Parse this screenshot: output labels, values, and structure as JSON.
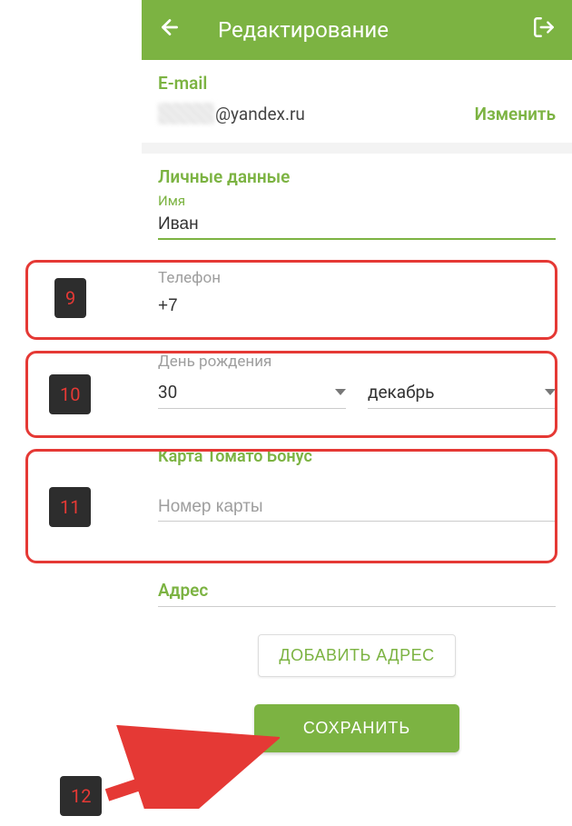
{
  "header": {
    "title": "Редактирование"
  },
  "email": {
    "label": "E-mail",
    "domain": "@yandex.ru",
    "change": "Изменить"
  },
  "personal": {
    "label": "Личные данные",
    "name_label": "Имя",
    "name_value": "Иван",
    "phone_label": "Телефон",
    "phone_value": "+7",
    "dob_label": "День рождения",
    "day_value": "30",
    "month_value": "декабрь"
  },
  "bonus": {
    "label": "Карта Томато Бонус",
    "placeholder": "Номер карты"
  },
  "address": {
    "label": "Адрес",
    "add_button": "ДОБАВИТЬ АДРЕС"
  },
  "save": {
    "label": "СОХРАНИТЬ"
  },
  "callouts": {
    "c9": "9",
    "c10": "10",
    "c11": "11",
    "c12": "12"
  }
}
